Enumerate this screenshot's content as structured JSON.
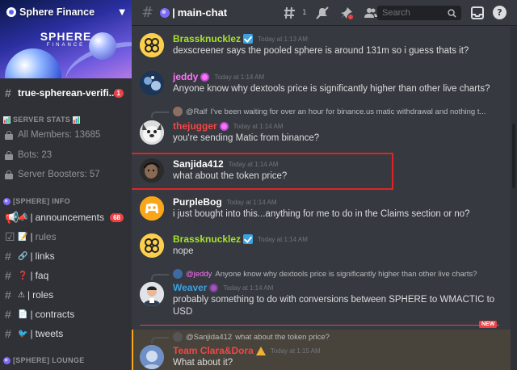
{
  "server": {
    "name": "Sphere Finance",
    "banner_title": "SPHERE",
    "banner_subtitle": "FINANCE"
  },
  "sidebar": {
    "top_channel": {
      "label": "true-spherean-verifi...",
      "badge": "1"
    },
    "categories": [
      {
        "label": "SERVER STATS",
        "suffix_icon": "chart-emoji"
      },
      {
        "label": "[SPHERE] INFO"
      },
      {
        "label": "[SPHERE] LOUNGE"
      }
    ],
    "stats": [
      {
        "label": "All Members: 13685"
      },
      {
        "label": "Bots: 23"
      },
      {
        "label": "Server Boosters: 57"
      }
    ],
    "channels": [
      {
        "label": "announcements",
        "icon": "megaphone-emoji",
        "badge": "68"
      },
      {
        "label": "rules",
        "icon": "memo-emoji"
      },
      {
        "label": "links",
        "icon": "link-emoji"
      },
      {
        "label": "faq",
        "icon": "question-emoji"
      },
      {
        "label": "roles",
        "icon": "warning-emoji"
      },
      {
        "label": "contracts",
        "icon": "page-emoji"
      },
      {
        "label": "tweets",
        "icon": "bird-emoji"
      }
    ]
  },
  "topbar": {
    "channel_name": "main-chat",
    "threads_count": "1",
    "search_placeholder": "Search"
  },
  "messages": [
    {
      "author": "Brassknucklez",
      "color": "#a6e22e",
      "verified": true,
      "time": "Today at 1:13 AM",
      "text": "dexscreener says the pooled sphere is around 131m so i guess thats it?"
    },
    {
      "author": "jeddy",
      "color": "#ff73fa",
      "time": "Today at 1:14 AM",
      "text": "Anyone know why dextools price is significantly higher than other live charts?"
    },
    {
      "reply_name": "@Ralf",
      "reply_text": "I've been waiting for over an hour for binance.us matic withdrawal and nothing t...",
      "author": "thejugger",
      "color": "#f04747",
      "time": "Today at 1:14 AM",
      "text": "you're sending Matic from binance?"
    },
    {
      "author": "Sanjida412",
      "color": "#ffffff",
      "time": "Today at 1:14 AM",
      "text": "what about the token price?"
    },
    {
      "author": "PurpleBog",
      "color": "#ffffff",
      "time": "Today at 1:14 AM",
      "text": "i just bought into this...anything for me to do in the Claims section or no?"
    },
    {
      "author": "Brassknucklez",
      "color": "#a6e22e",
      "verified": true,
      "time": "Today at 1:14 AM",
      "text": "nope"
    },
    {
      "reply_name": "@jeddy",
      "reply_text": "Anyone know why dextools price is significantly higher than other live charts?",
      "author": "Weaver",
      "color": "#3ba2e0",
      "time": "Today at 1:14 AM",
      "text": "probably something to do with conversions between SPHERE to WMACTIC to USD"
    },
    {
      "reply_name": "@Sanjida412",
      "reply_text": "what about the token price?",
      "author": "Team Clara&Dora",
      "color": "#f04747",
      "time": "Today at 1:15 AM",
      "text": "What about it?"
    }
  ],
  "new_marker": "NEW"
}
